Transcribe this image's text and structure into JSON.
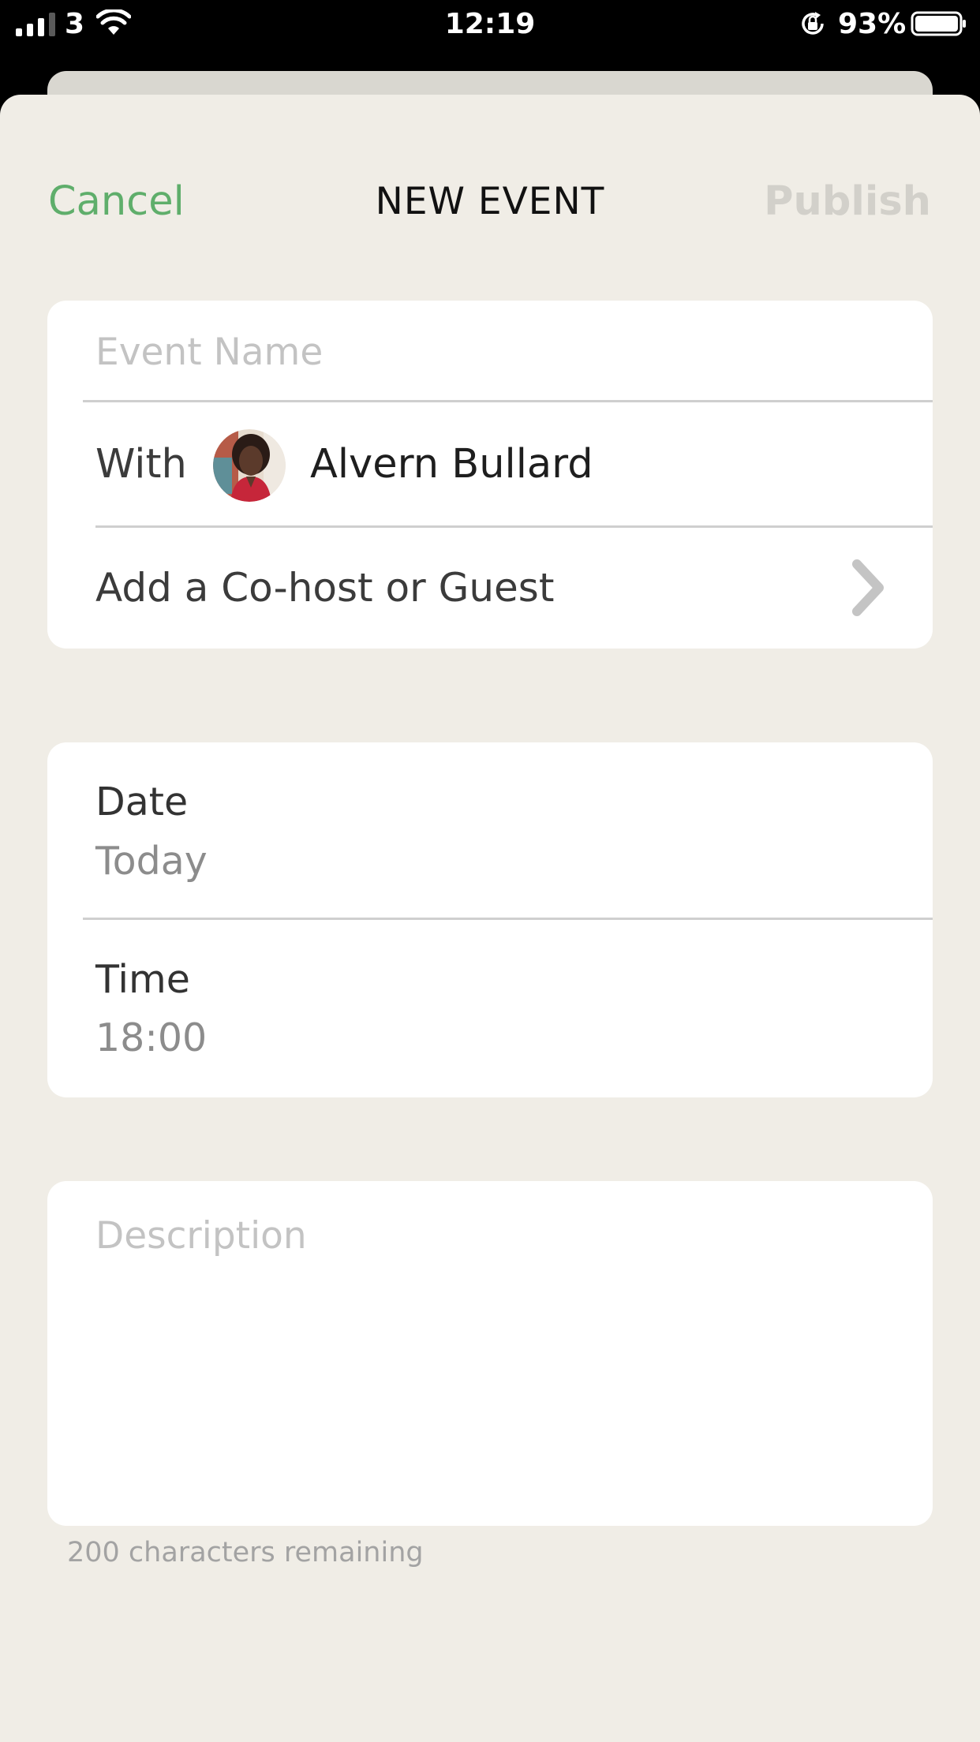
{
  "status_bar": {
    "carrier": "3",
    "time": "12:19",
    "battery_percent": "93%",
    "signal_bars_active": 3,
    "battery_level": 0.93,
    "icons": [
      "signal-icon",
      "wifi-icon",
      "orientation-lock-icon",
      "battery-icon"
    ]
  },
  "header": {
    "cancel_label": "Cancel",
    "title": "NEW EVENT",
    "publish_label": "Publish"
  },
  "details": {
    "event_name_placeholder": "Event Name",
    "with_label": "With",
    "host_name": "Alvern Bullard",
    "add_guest_label": "Add a Co-host or Guest"
  },
  "schedule": {
    "date_label": "Date",
    "date_value": "Today",
    "time_label": "Time",
    "time_value": "18:00"
  },
  "description": {
    "placeholder": "Description",
    "char_count": "200 characters remaining"
  },
  "colors": {
    "accent": "#5fae6b",
    "background": "#f0ede6",
    "disabled": "#d2d0ca"
  }
}
